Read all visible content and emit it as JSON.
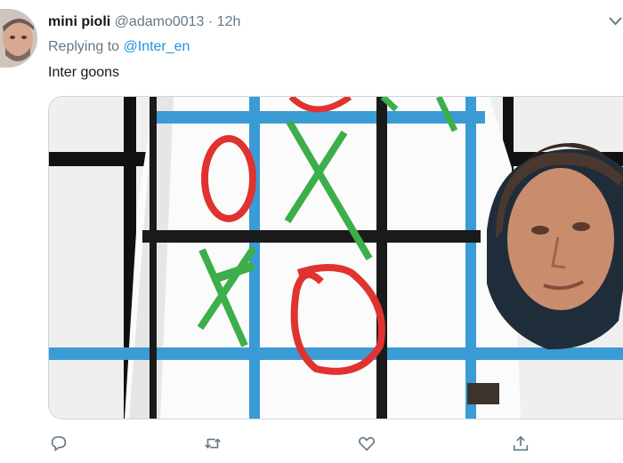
{
  "tweet": {
    "author_name": "mini pioli",
    "author_handle": "@adamo0013",
    "separator": "·",
    "timestamp": "12h",
    "replying_label": "Replying to",
    "replying_to": "@Inter_en",
    "text": "Inter goons"
  },
  "icons": {
    "reply": "reply-icon",
    "retweet": "retweet-icon",
    "like": "heart-icon",
    "share": "share-icon",
    "caret": "chevron-down-icon"
  },
  "colors": {
    "text_primary": "#14171a",
    "text_secondary": "#657786",
    "link": "#1b95e0",
    "grid_blue": "#3a9bd5",
    "mark_red": "#e0332f",
    "mark_green": "#3cae4a"
  }
}
